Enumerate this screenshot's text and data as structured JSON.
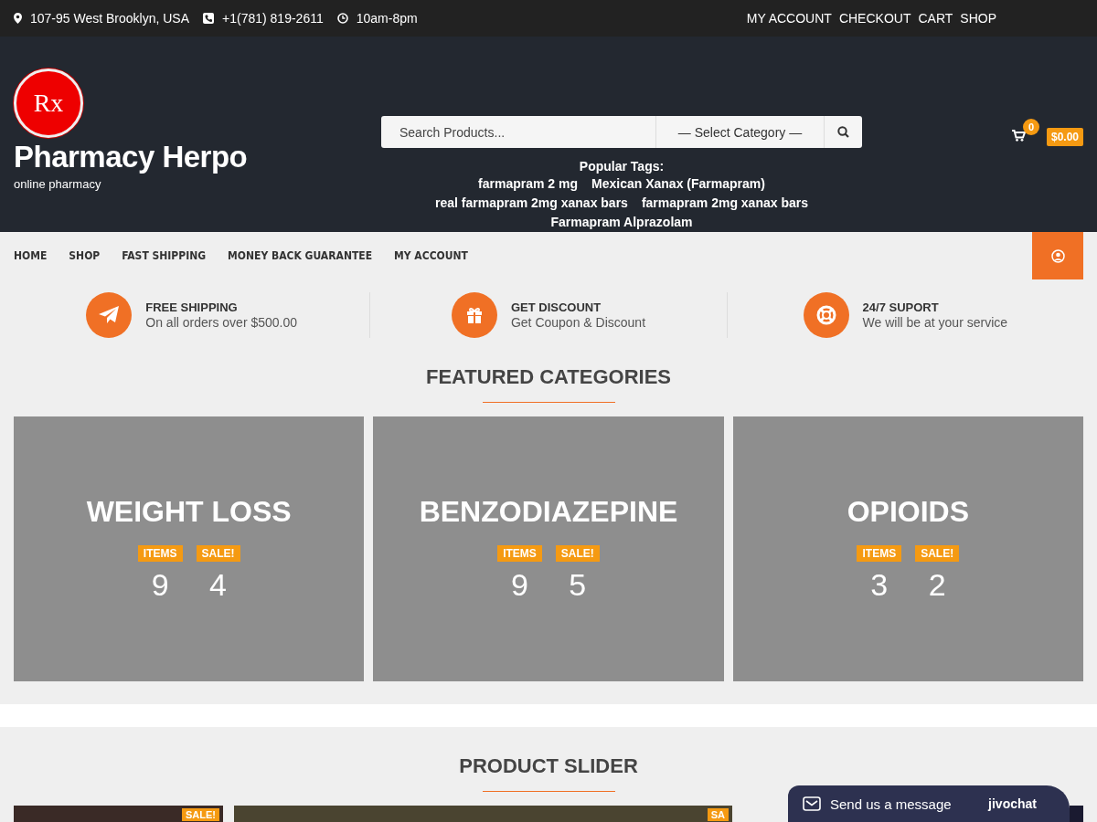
{
  "topbar": {
    "contacts": [
      {
        "kind": "pin",
        "text": "107-95 West Brooklyn, USA"
      },
      {
        "kind": "phone",
        "text": "+1(781) 819-2611"
      },
      {
        "kind": "clock",
        "text": "10am-8pm"
      }
    ],
    "links": [
      "MY ACCOUNT",
      "CHECKOUT",
      "CART",
      "SHOP"
    ]
  },
  "header": {
    "logo_mark": "Rx",
    "site_name": "Pharmacy Herpo",
    "tagline": "online pharmacy",
    "search": {
      "placeholder": "Search Products...",
      "category": "— Select Category —"
    },
    "tags_title": "Popular Tags:",
    "tag_lines": [
      [
        "farmapram 2 mg",
        "Mexican Xanax (Farmapram)"
      ],
      [
        "real farmapram 2mg xanax bars",
        "farmapram 2mg xanax bars"
      ],
      [
        "Farmapram Alprazolam"
      ]
    ],
    "cart": {
      "count": "0",
      "total": "$0.00"
    }
  },
  "nav": [
    "HOME",
    "SHOP",
    "FAST SHIPPING",
    "MONEY BACK GUARANTEE",
    "MY ACCOUNT"
  ],
  "features": [
    {
      "kind": "plane",
      "title": "FREE SHIPPING",
      "text": "On all orders over $500.00"
    },
    {
      "kind": "gift",
      "title": "GET DISCOUNT",
      "text": "Get Coupon & Discount"
    },
    {
      "kind": "lifebuoy",
      "title": "24/7 SUPORT",
      "text": "We will be at your service"
    }
  ],
  "featured": {
    "title": "FEATURED CATEGORIES",
    "categories": [
      {
        "name": "WEIGHT LOSS",
        "items_label": "ITEMS",
        "items": "9",
        "sale_label": "SALE!",
        "sale": "4"
      },
      {
        "name": "BENZODIAZEPINE",
        "items_label": "ITEMS",
        "items": "9",
        "sale_label": "SALE!",
        "sale": "5"
      },
      {
        "name": "OPIOIDS",
        "items_label": "ITEMS",
        "items": "3",
        "sale_label": "SALE!",
        "sale": "2"
      }
    ]
  },
  "slider": {
    "title": "PRODUCT SLIDER",
    "products": [
      {
        "badge": "SALE!"
      },
      {
        "badge": "SA"
      }
    ]
  },
  "chat": {
    "text": "Send us a message",
    "brand": "jivochat"
  }
}
